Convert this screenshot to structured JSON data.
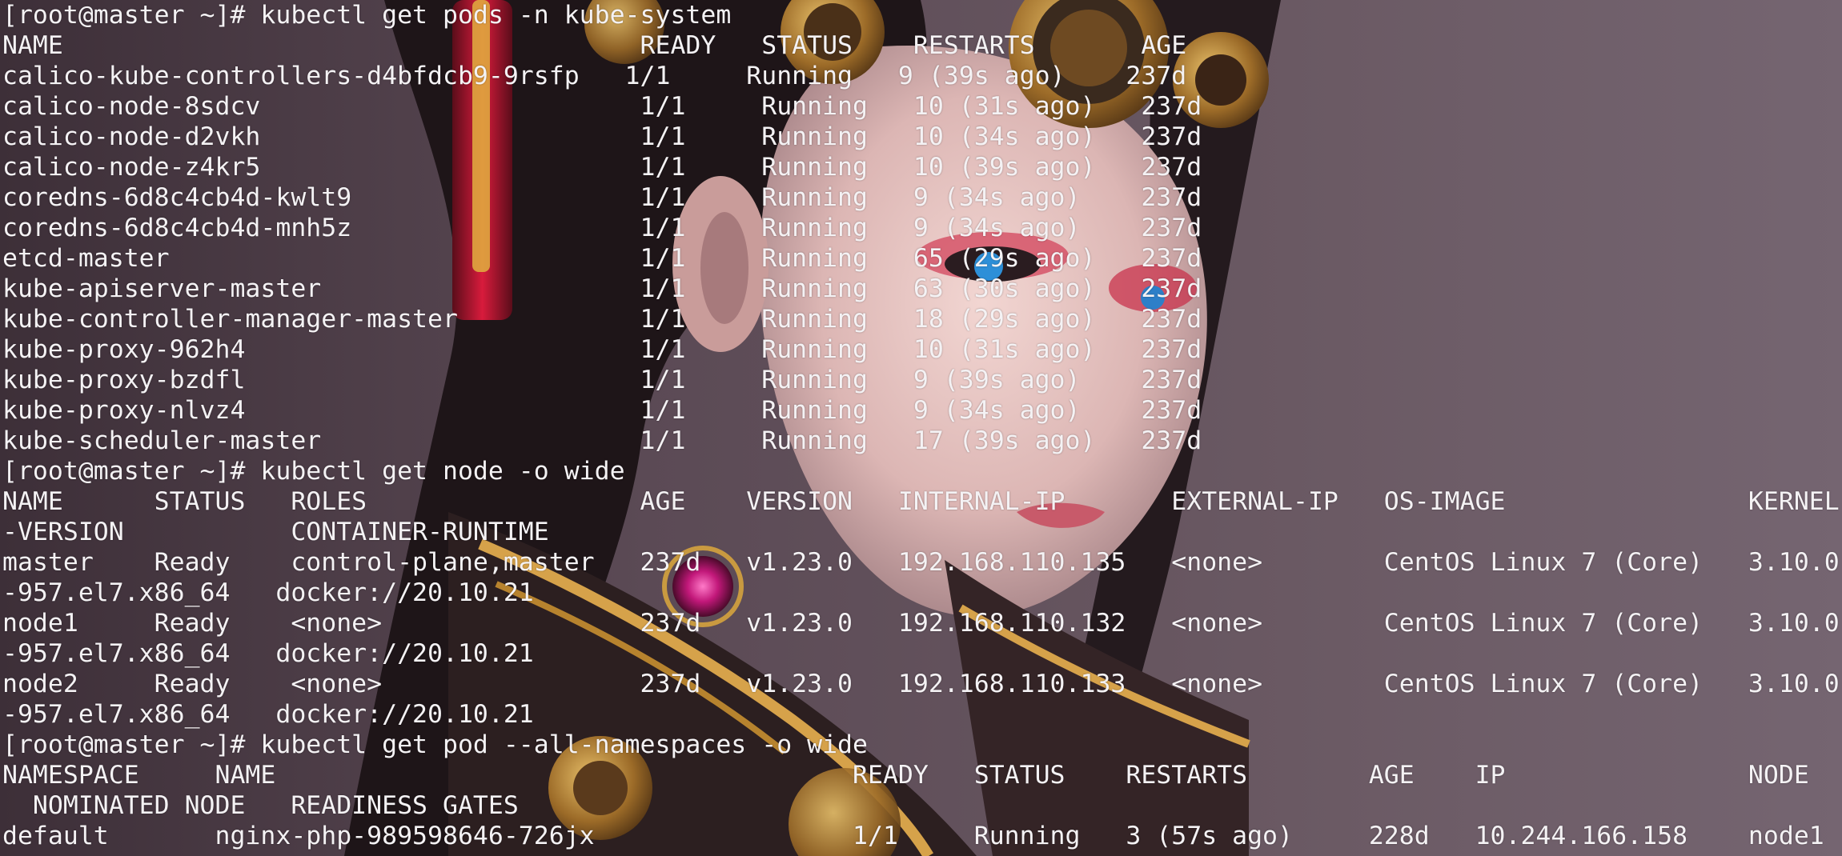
{
  "theme": {
    "text_color": "#f4f2f4",
    "background_color": "#5a4c55"
  },
  "wallpaper": {
    "subject": "steampunk-woman-illustration"
  },
  "terminal": {
    "lines": [
      "[root@master ~]# kubectl get pods -n kube-system",
      "NAME                                      READY   STATUS    RESTARTS       AGE",
      "calico-kube-controllers-d4bfdcb9-9rsfp   1/1     Running   9 (39s ago)    237d",
      "calico-node-8sdcv                         1/1     Running   10 (31s ago)   237d",
      "calico-node-d2vkh                         1/1     Running   10 (34s ago)   237d",
      "calico-node-z4kr5                         1/1     Running   10 (39s ago)   237d",
      "coredns-6d8c4cb4d-kwlt9                   1/1     Running   9 (34s ago)    237d",
      "coredns-6d8c4cb4d-mnh5z                   1/1     Running   9 (34s ago)    237d",
      "etcd-master                               1/1     Running   65 (29s ago)   237d",
      "kube-apiserver-master                     1/1     Running   63 (30s ago)   237d",
      "kube-controller-manager-master            1/1     Running   18 (29s ago)   237d",
      "kube-proxy-962h4                          1/1     Running   10 (31s ago)   237d",
      "kube-proxy-bzdfl                          1/1     Running   9 (39s ago)    237d",
      "kube-proxy-nlvz4                          1/1     Running   9 (34s ago)    237d",
      "kube-scheduler-master                     1/1     Running   17 (39s ago)   237d",
      "[root@master ~]# kubectl get node -o wide",
      "NAME      STATUS   ROLES                  AGE    VERSION   INTERNAL-IP       EXTERNAL-IP   OS-IMAGE                KERNEL",
      "-VERSION           CONTAINER-RUNTIME",
      "master    Ready    control-plane,master   237d   v1.23.0   192.168.110.135   <none>        CentOS Linux 7 (Core)   3.10.0",
      "-957.el7.x86_64   docker://20.10.21",
      "node1     Ready    <none>                 237d   v1.23.0   192.168.110.132   <none>        CentOS Linux 7 (Core)   3.10.0",
      "-957.el7.x86_64   docker://20.10.21",
      "node2     Ready    <none>                 237d   v1.23.0   192.168.110.133   <none>        CentOS Linux 7 (Core)   3.10.0",
      "-957.el7.x86_64   docker://20.10.21",
      "[root@master ~]# kubectl get pod --all-namespaces -o wide",
      "NAMESPACE     NAME                                      READY   STATUS    RESTARTS        AGE    IP                NODE",
      "  NOMINATED NODE   READINESS GATES",
      "default       nginx-php-989598646-726jx                 1/1     Running   3 (57s ago)     228d   10.244.166.158    node1"
    ]
  }
}
